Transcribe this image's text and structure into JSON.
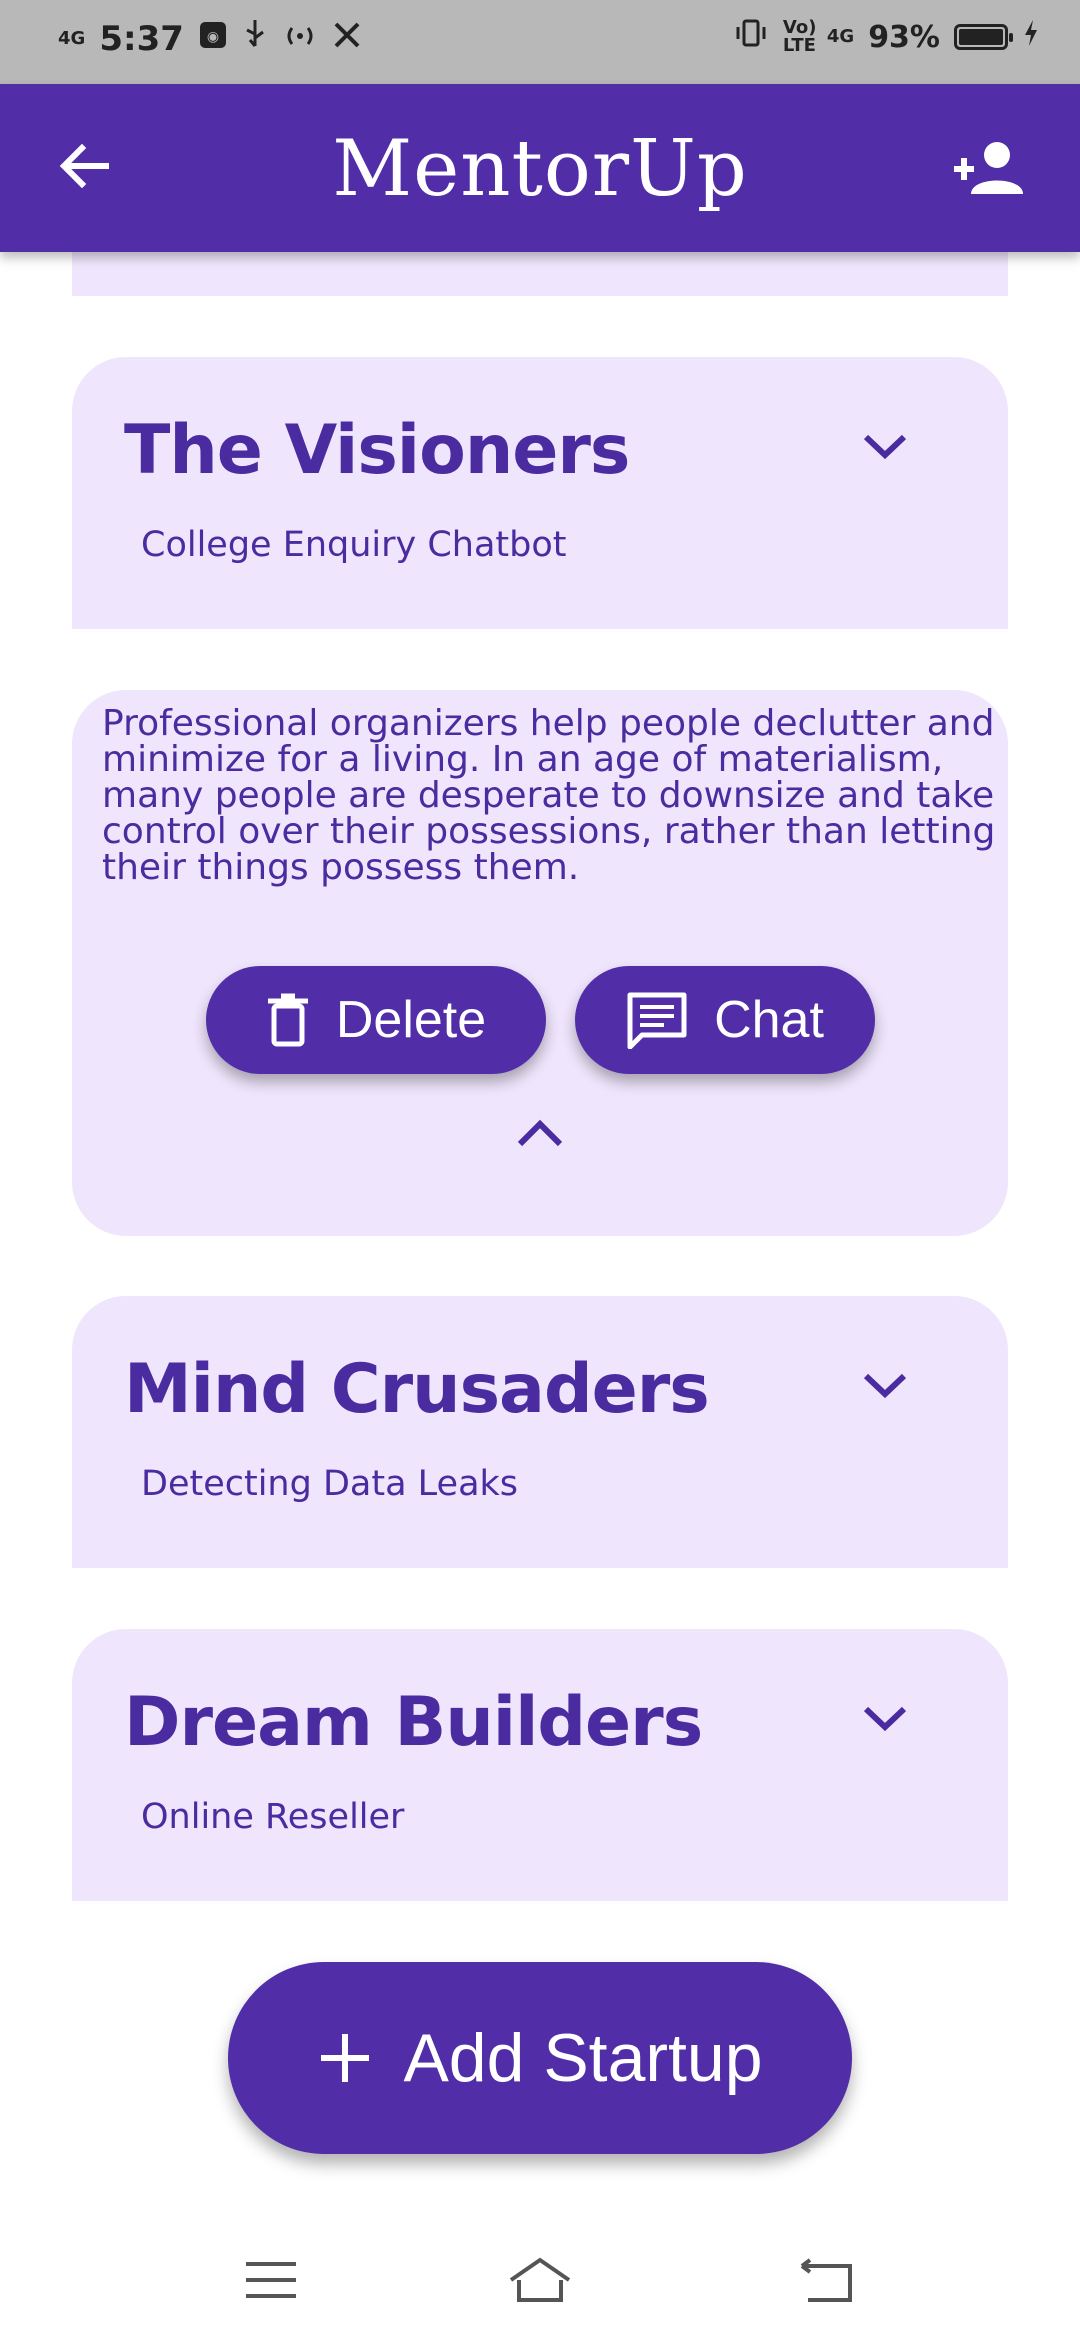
{
  "status_bar": {
    "time": "5:37",
    "network_left": "4G",
    "volte": "Vo) LTE",
    "network_right": "4G",
    "battery": "93%"
  },
  "app_bar": {
    "title": "MentorUp"
  },
  "startups": [
    {
      "name": "The Visioners",
      "project": "College Enquiry Chatbot",
      "description": "Professional organizers help people declutter and minimize for a living. In an age of materialism, many people are desperate to downsize and take control over their possessions, rather than letting their things possess them.",
      "delete_label": "Delete",
      "chat_label": "Chat"
    },
    {
      "name": "Mind Crusaders",
      "project": "Detecting Data Leaks"
    },
    {
      "name": "Dream Builders",
      "project": "Online Reseller"
    }
  ],
  "add_button": {
    "label": "Add Startup"
  },
  "icons": {
    "back": "arrow-left-icon",
    "add_user": "person-add-icon",
    "expand": "chevron-down-icon",
    "collapse": "chevron-up-icon",
    "delete": "trash-icon",
    "chat": "chat-bubble-icon",
    "add": "plus-icon"
  },
  "colors": {
    "primary": "#522da8",
    "card_background": "#efe5fc",
    "text_primary": "#4a2ba0"
  }
}
